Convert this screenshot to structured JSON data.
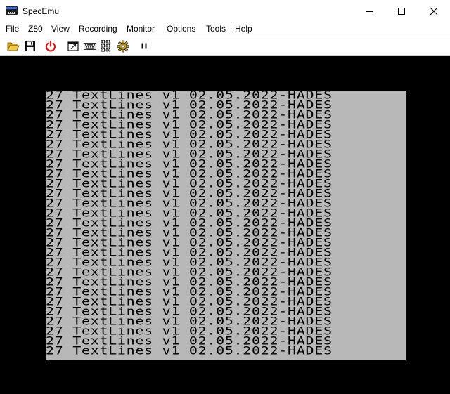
{
  "window": {
    "title": "SpecEmu",
    "controls": {
      "minimize": "minimize-icon",
      "maximize": "maximize-icon",
      "close": "close-icon"
    }
  },
  "menu": [
    {
      "label": "File"
    },
    {
      "label": "Z80"
    },
    {
      "label": "View"
    },
    {
      "label": "Recording"
    },
    {
      "label": "Monitor"
    },
    {
      "label": "Options"
    },
    {
      "label": "Tools"
    },
    {
      "label": "Help"
    }
  ],
  "toolbar": {
    "items": [
      {
        "icon": "open-folder-icon"
      },
      {
        "icon": "save-disk-icon"
      },
      {
        "icon": "power-icon"
      },
      {
        "icon": "window-resize-icon"
      },
      {
        "icon": "keyboard-icon"
      },
      {
        "icon": "binary-display-icon",
        "text": [
          "0101",
          "1101",
          "1100"
        ]
      },
      {
        "icon": "gear-settings-icon"
      },
      {
        "icon": "pause-icon"
      }
    ]
  },
  "screen": {
    "paper_color": "#b8b8b8",
    "border_color": "#000000",
    "ink_color": "#000000",
    "lines": [
      "27 TextLines v1 02.05.2022-HADES",
      "27 TextLines v1 02.05.2022-HADES",
      "27 TextLines v1 02.05.2022-HADES",
      "27 TextLines v1 02.05.2022-HADES",
      "27 TextLines v1 02.05.2022-HADES",
      "27 TextLines v1 02.05.2022-HADES",
      "27 TextLines v1 02.05.2022-HADES",
      "27 TextLines v1 02.05.2022-HADES",
      "27 TextLines v1 02.05.2022-HADES",
      "27 TextLines v1 02.05.2022-HADES",
      "27 TextLines v1 02.05.2022-HADES",
      "27 TextLines v1 02.05.2022-HADES",
      "27 TextLines v1 02.05.2022-HADES",
      "27 TextLines v1 02.05.2022-HADES",
      "27 TextLines v1 02.05.2022-HADES",
      "27 TextLines v1 02.05.2022-HADES",
      "27 TextLines v1 02.05.2022-HADES",
      "27 TextLines v1 02.05.2022-HADES",
      "27 TextLines v1 02.05.2022-HADES",
      "27 TextLines v1 02.05.2022-HADES",
      "27 TextLines v1 02.05.2022-HADES",
      "27 TextLines v1 02.05.2022-HADES",
      "27 TextLines v1 02.05.2022-HADES",
      "27 TextLines v1 02.05.2022-HADES",
      "27 TextLines v1 02.05.2022-HADES",
      "27 TextLines v1 02.05.2022-HADES",
      "27 TextLines v1 02.05.2022-HADES"
    ]
  }
}
